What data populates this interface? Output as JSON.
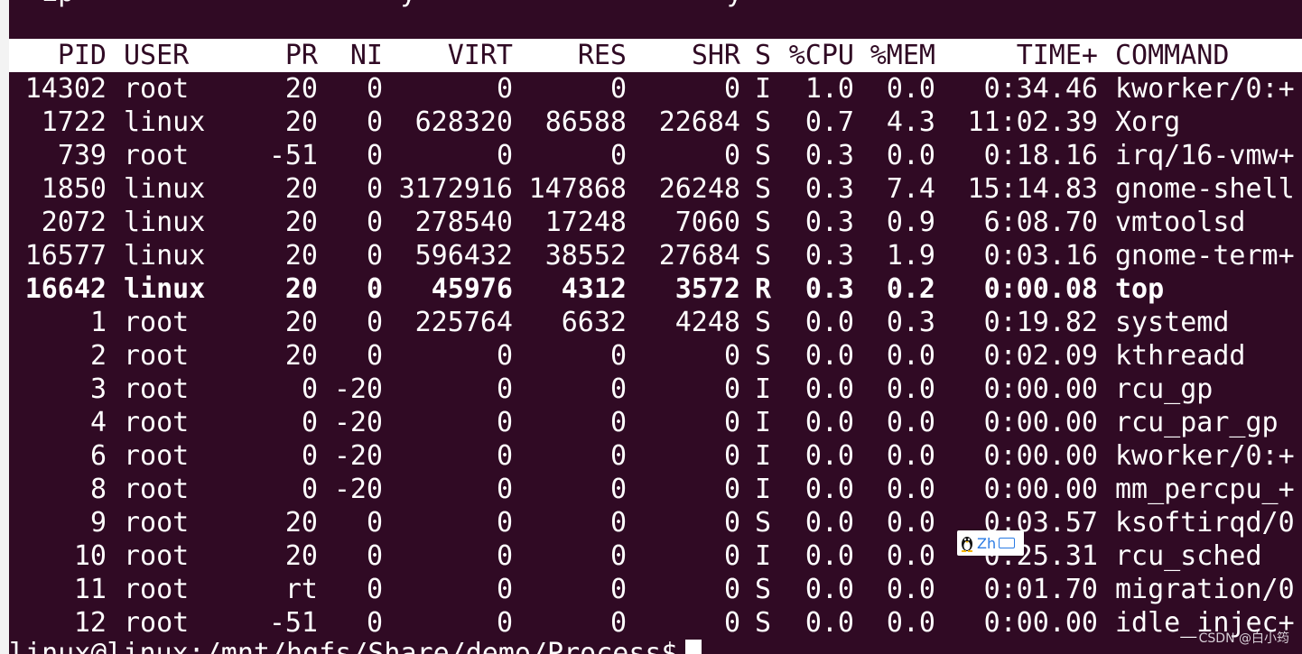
{
  "colors": {
    "terminal_bg": "#300a24",
    "terminal_fg": "#ffffff",
    "header_bg": "#ffffff",
    "header_fg": "#300a24"
  },
  "top_partial_line": "  ip                    y                   y",
  "header": {
    "pid": "PID",
    "user": "USER",
    "pr": "PR",
    "ni": "NI",
    "virt": "VIRT",
    "res": "RES",
    "shr": "SHR",
    "s": "S",
    "cpu": "%CPU",
    "mem": "%MEM",
    "time": "TIME+",
    "command": "COMMAND"
  },
  "processes": [
    {
      "pid": "14302",
      "user": "root",
      "pr": "20",
      "ni": "0",
      "virt": "0",
      "res": "0",
      "shr": "0",
      "s": "I",
      "cpu": "1.0",
      "mem": "0.0",
      "time": "0:34.46",
      "command": "kworker/0:+"
    },
    {
      "pid": "1722",
      "user": "linux",
      "pr": "20",
      "ni": "0",
      "virt": "628320",
      "res": "86588",
      "shr": "22684",
      "s": "S",
      "cpu": "0.7",
      "mem": "4.3",
      "time": "11:02.39",
      "command": "Xorg"
    },
    {
      "pid": "739",
      "user": "root",
      "pr": "-51",
      "ni": "0",
      "virt": "0",
      "res": "0",
      "shr": "0",
      "s": "S",
      "cpu": "0.3",
      "mem": "0.0",
      "time": "0:18.16",
      "command": "irq/16-vmw+"
    },
    {
      "pid": "1850",
      "user": "linux",
      "pr": "20",
      "ni": "0",
      "virt": "3172916",
      "res": "147868",
      "shr": "26248",
      "s": "S",
      "cpu": "0.3",
      "mem": "7.4",
      "time": "15:14.83",
      "command": "gnome-shell"
    },
    {
      "pid": "2072",
      "user": "linux",
      "pr": "20",
      "ni": "0",
      "virt": "278540",
      "res": "17248",
      "shr": "7060",
      "s": "S",
      "cpu": "0.3",
      "mem": "0.9",
      "time": "6:08.70",
      "command": "vmtoolsd"
    },
    {
      "pid": "16577",
      "user": "linux",
      "pr": "20",
      "ni": "0",
      "virt": "596432",
      "res": "38552",
      "shr": "27684",
      "s": "S",
      "cpu": "0.3",
      "mem": "1.9",
      "time": "0:03.16",
      "command": "gnome-term+"
    },
    {
      "pid": "16642",
      "user": "linux",
      "pr": "20",
      "ni": "0",
      "virt": "45976",
      "res": "4312",
      "shr": "3572",
      "s": "R",
      "cpu": "0.3",
      "mem": "0.2",
      "time": "0:00.08",
      "command": "top",
      "highlight": true
    },
    {
      "pid": "1",
      "user": "root",
      "pr": "20",
      "ni": "0",
      "virt": "225764",
      "res": "6632",
      "shr": "4248",
      "s": "S",
      "cpu": "0.0",
      "mem": "0.3",
      "time": "0:19.82",
      "command": "systemd"
    },
    {
      "pid": "2",
      "user": "root",
      "pr": "20",
      "ni": "0",
      "virt": "0",
      "res": "0",
      "shr": "0",
      "s": "S",
      "cpu": "0.0",
      "mem": "0.0",
      "time": "0:02.09",
      "command": "kthreadd"
    },
    {
      "pid": "3",
      "user": "root",
      "pr": "0",
      "ni": "-20",
      "virt": "0",
      "res": "0",
      "shr": "0",
      "s": "I",
      "cpu": "0.0",
      "mem": "0.0",
      "time": "0:00.00",
      "command": "rcu_gp"
    },
    {
      "pid": "4",
      "user": "root",
      "pr": "0",
      "ni": "-20",
      "virt": "0",
      "res": "0",
      "shr": "0",
      "s": "I",
      "cpu": "0.0",
      "mem": "0.0",
      "time": "0:00.00",
      "command": "rcu_par_gp"
    },
    {
      "pid": "6",
      "user": "root",
      "pr": "0",
      "ni": "-20",
      "virt": "0",
      "res": "0",
      "shr": "0",
      "s": "I",
      "cpu": "0.0",
      "mem": "0.0",
      "time": "0:00.00",
      "command": "kworker/0:+"
    },
    {
      "pid": "8",
      "user": "root",
      "pr": "0",
      "ni": "-20",
      "virt": "0",
      "res": "0",
      "shr": "0",
      "s": "I",
      "cpu": "0.0",
      "mem": "0.0",
      "time": "0:00.00",
      "command": "mm_percpu_+"
    },
    {
      "pid": "9",
      "user": "root",
      "pr": "20",
      "ni": "0",
      "virt": "0",
      "res": "0",
      "shr": "0",
      "s": "S",
      "cpu": "0.0",
      "mem": "0.0",
      "time": "0:03.57",
      "command": "ksoftirqd/0"
    },
    {
      "pid": "10",
      "user": "root",
      "pr": "20",
      "ni": "0",
      "virt": "0",
      "res": "0",
      "shr": "0",
      "s": "I",
      "cpu": "0.0",
      "mem": "0.0",
      "time": "0:25.31",
      "command": "rcu_sched"
    },
    {
      "pid": "11",
      "user": "root",
      "pr": "rt",
      "ni": "0",
      "virt": "0",
      "res": "0",
      "shr": "0",
      "s": "S",
      "cpu": "0.0",
      "mem": "0.0",
      "time": "0:01.70",
      "command": "migration/0"
    },
    {
      "pid": "12",
      "user": "root",
      "pr": "-51",
      "ni": "0",
      "virt": "0",
      "res": "0",
      "shr": "0",
      "s": "S",
      "cpu": "0.0",
      "mem": "0.0",
      "time": "0:00.00",
      "command": "idle_injec+"
    }
  ],
  "prompt": "linux@linux:/mnt/hgfs/Share/demo/Process$",
  "ime_indicator": {
    "label": "Zh",
    "icon": "penguin-icon",
    "keyboard_icon": "keyboard-icon"
  },
  "watermark": "CSDN @白小筠"
}
